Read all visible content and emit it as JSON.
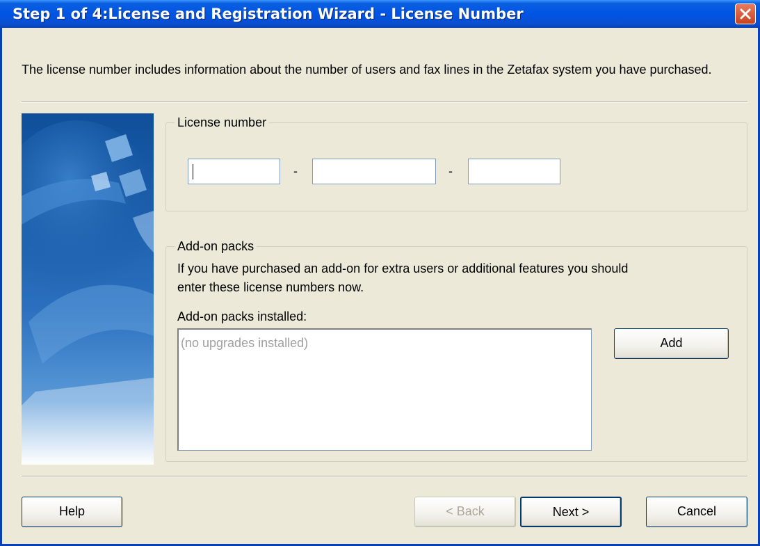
{
  "window": {
    "title": "Step 1 of 4:License and Registration Wizard - License Number"
  },
  "intro_text": "The license number includes information about the number of users and fax lines in the Zetafax system you have purchased.",
  "license_group": {
    "legend": "License number",
    "fields": [
      {
        "value": "",
        "placeholder": ""
      },
      {
        "value": "",
        "placeholder": ""
      },
      {
        "value": "",
        "placeholder": ""
      }
    ],
    "separator": "-"
  },
  "addon_group": {
    "legend": "Add-on packs",
    "description_line1": "If you have purchased an add-on for extra users or additional features you should",
    "description_line2": "enter these license numbers now.",
    "installed_label": "Add-on packs installed:",
    "installed_items": [
      "(no upgrades installed)"
    ],
    "add_button": "Add"
  },
  "buttons": {
    "help": "Help",
    "back": "< Back",
    "next": "Next >",
    "cancel": "Cancel"
  },
  "icons": {
    "close": "close-icon",
    "banner": "zetafax-banner-graphic"
  },
  "colors": {
    "titlebar": "#0054e3",
    "face": "#ece9d8",
    "close_button": "#c8441f",
    "banner_blue": "#1b5da8"
  }
}
